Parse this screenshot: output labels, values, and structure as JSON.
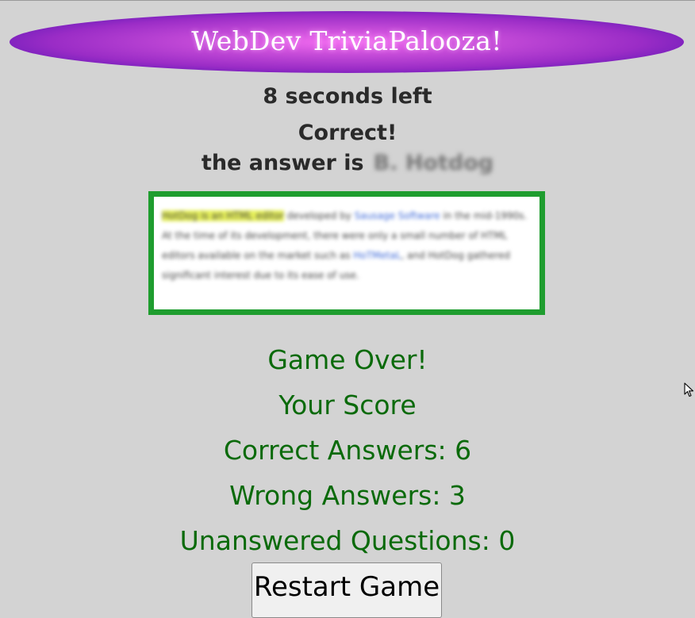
{
  "header": {
    "title": "WebDev TriviaPalooza!"
  },
  "status": {
    "timer": "8 seconds left",
    "result": "Correct!",
    "answer_prefix": "the answer is",
    "answer_value": "B. Hotdog"
  },
  "answer_box": {
    "highlight": "HotDog is an HTML editor",
    "text_before_link": " developed by ",
    "link1": "Sausage Software",
    "text_after_link1": " in the mid-1990s. At the time of its development, there were only a small number of HTML editors available on the market such as ",
    "link2": "HoTMetaL",
    "text_end": ", and HotDog gathered significant interest due to its ease of use."
  },
  "game_over": {
    "title": "Game Over!",
    "score_heading": "Your Score",
    "correct_label": "Correct Answers: 6",
    "wrong_label": "Wrong Answers: 3",
    "unanswered_label": "Unanswered Questions: 0"
  },
  "actions": {
    "restart_label": "Restart Game"
  },
  "colors": {
    "background": "#d3d3d3",
    "banner_center": "#f36cf0",
    "banner_edge": "#4a10aa",
    "answer_border": "#1f9d2f",
    "score_text": "#0a6a0a"
  },
  "icons": {
    "cursor": "mouse-pointer-icon"
  }
}
